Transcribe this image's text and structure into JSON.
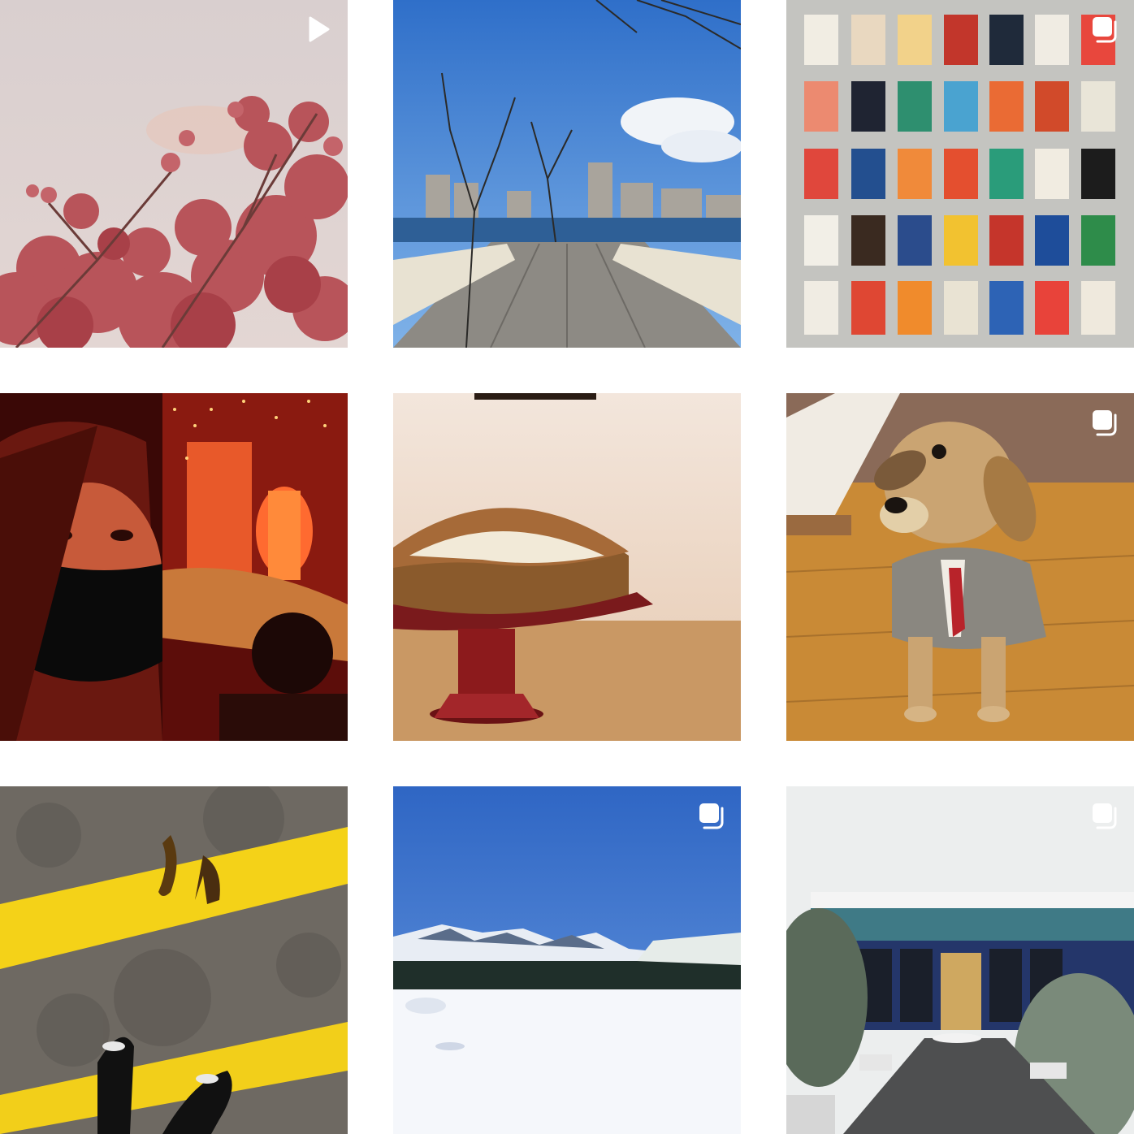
{
  "grid": {
    "posts": [
      {
        "kind": "reel",
        "badge_icon": "play-icon",
        "subject": "cherry-blossoms"
      },
      {
        "kind": "photo",
        "badge_icon": "",
        "subject": "park-bridge-skyline"
      },
      {
        "kind": "carousel",
        "badge_icon": "carousel-icon",
        "subject": "poster-wall"
      },
      {
        "kind": "photo",
        "badge_icon": "",
        "subject": "theater-selfie"
      },
      {
        "kind": "photo",
        "badge_icon": "",
        "subject": "cake-on-stand"
      },
      {
        "kind": "carousel",
        "badge_icon": "carousel-icon",
        "subject": "dog-in-suit"
      },
      {
        "kind": "photo",
        "badge_icon": "",
        "subject": "banana-peels-street"
      },
      {
        "kind": "carousel",
        "badge_icon": "carousel-icon",
        "subject": "snowy-mountain-lake"
      },
      {
        "kind": "carousel",
        "badge_icon": "carousel-icon",
        "subject": "snowy-tiled-building"
      }
    ]
  },
  "colors": {
    "background": "#ffffff",
    "badge": "#ffffff"
  }
}
